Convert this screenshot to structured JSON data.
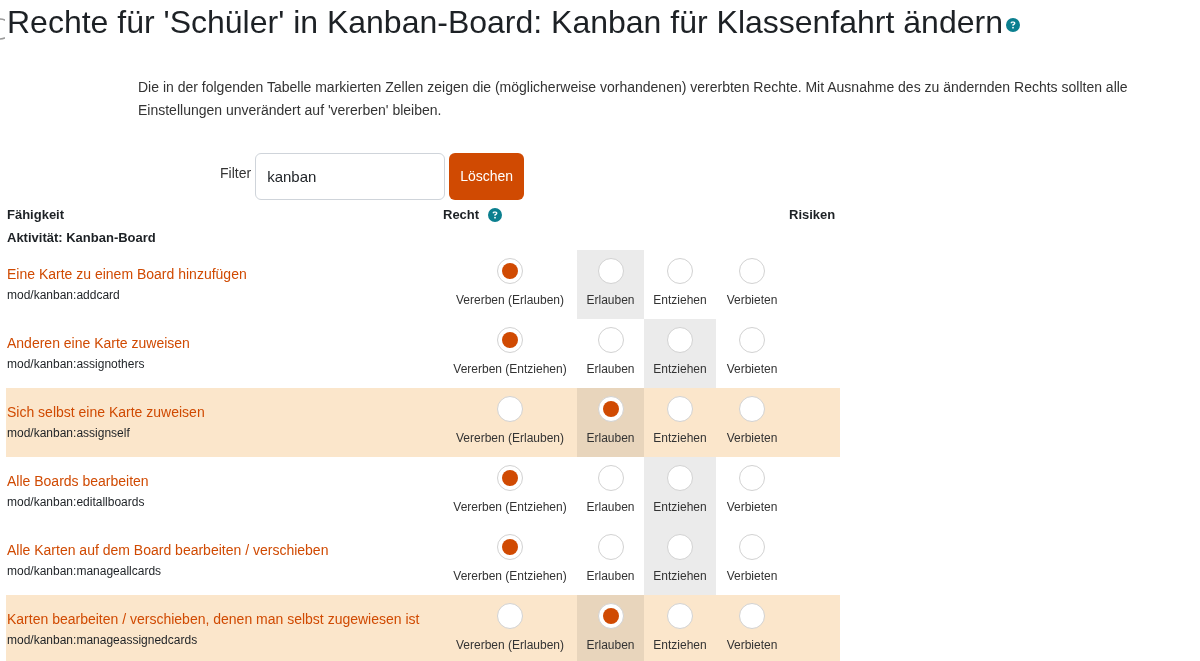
{
  "title": "Rechte für 'Schüler' in Kanban-Board: Kanban für Klassenfahrt ändern",
  "description": "Die in der folgenden Tabelle markierten Zellen zeigen die (möglicherweise vorhandenen) vererbten Rechte. Mit Ausnahme des zu ändernden Rechts sollten alle Einstellungen unverändert auf 'vererben' bleiben.",
  "filter": {
    "label": "Filter",
    "value": "kanban",
    "clear_button": "Löschen"
  },
  "table": {
    "columns": [
      "Fähigkeit",
      "Recht",
      "Risiken"
    ],
    "section": "Aktivität: Kanban-Board",
    "rows": [
      {
        "name": "Eine Karte zu einem Board hinzufügen",
        "capability": "mod/kanban:addcard",
        "changed": false,
        "options": [
          {
            "label": "Vererben (Erlauben)",
            "selected": true,
            "inherited": false
          },
          {
            "label": "Erlauben",
            "selected": false,
            "inherited": true
          },
          {
            "label": "Entziehen",
            "selected": false,
            "inherited": false
          },
          {
            "label": "Verbieten",
            "selected": false,
            "inherited": false
          }
        ]
      },
      {
        "name": "Anderen eine Karte zuweisen",
        "capability": "mod/kanban:assignothers",
        "changed": false,
        "options": [
          {
            "label": "Vererben (Entziehen)",
            "selected": true,
            "inherited": false
          },
          {
            "label": "Erlauben",
            "selected": false,
            "inherited": false
          },
          {
            "label": "Entziehen",
            "selected": false,
            "inherited": true
          },
          {
            "label": "Verbieten",
            "selected": false,
            "inherited": false
          }
        ]
      },
      {
        "name": "Sich selbst eine Karte zuweisen",
        "capability": "mod/kanban:assignself",
        "changed": true,
        "options": [
          {
            "label": "Vererben (Erlauben)",
            "selected": false,
            "inherited": false
          },
          {
            "label": "Erlauben",
            "selected": true,
            "inherited": true
          },
          {
            "label": "Entziehen",
            "selected": false,
            "inherited": false
          },
          {
            "label": "Verbieten",
            "selected": false,
            "inherited": false
          }
        ]
      },
      {
        "name": "Alle Boards bearbeiten",
        "capability": "mod/kanban:editallboards",
        "changed": false,
        "options": [
          {
            "label": "Vererben (Entziehen)",
            "selected": true,
            "inherited": false
          },
          {
            "label": "Erlauben",
            "selected": false,
            "inherited": false
          },
          {
            "label": "Entziehen",
            "selected": false,
            "inherited": true
          },
          {
            "label": "Verbieten",
            "selected": false,
            "inherited": false
          }
        ]
      },
      {
        "name": "Alle Karten auf dem Board bearbeiten / verschieben",
        "capability": "mod/kanban:manageallcards",
        "changed": false,
        "options": [
          {
            "label": "Vererben (Entziehen)",
            "selected": true,
            "inherited": false
          },
          {
            "label": "Erlauben",
            "selected": false,
            "inherited": false
          },
          {
            "label": "Entziehen",
            "selected": false,
            "inherited": true
          },
          {
            "label": "Verbieten",
            "selected": false,
            "inherited": false
          }
        ]
      },
      {
        "name": "Karten bearbeiten / verschieben, denen man selbst zugewiesen ist",
        "capability": "mod/kanban:manageassignedcards",
        "changed": true,
        "options": [
          {
            "label": "Vererben (Erlauben)",
            "selected": false,
            "inherited": false
          },
          {
            "label": "Erlauben",
            "selected": true,
            "inherited": true
          },
          {
            "label": "Entziehen",
            "selected": false,
            "inherited": false
          },
          {
            "label": "Verbieten",
            "selected": false,
            "inherited": false
          }
        ]
      }
    ]
  }
}
